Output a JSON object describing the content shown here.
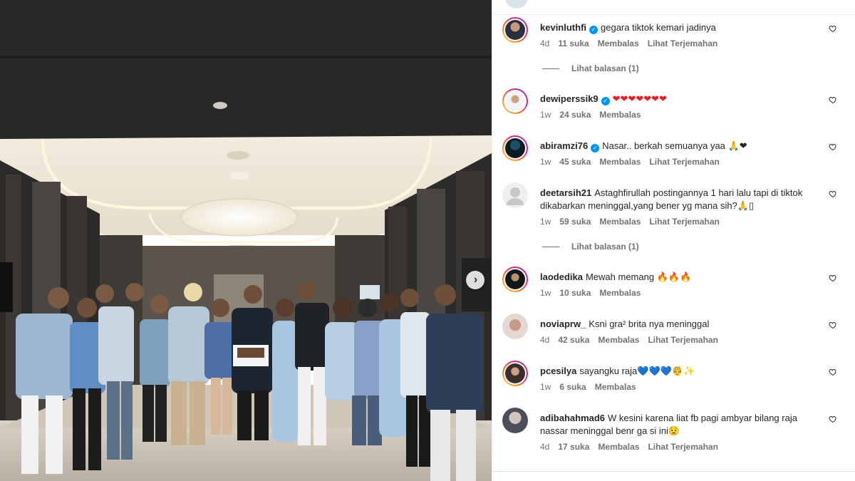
{
  "post": {
    "next_icon": "chevron-right-icon"
  },
  "comments": [
    {
      "username": "kevinluthfi",
      "verified": true,
      "text": "gegara tiktok kemari jadinya",
      "time": "4d",
      "likes": "11 suka",
      "reply": "Membalas",
      "translate": "Lihat Terjemahan",
      "view_replies": "Lihat balasan (1)"
    },
    {
      "username": "dewiperssik9",
      "verified": true,
      "text": "❤❤❤❤❤❤❤",
      "time": "1w",
      "likes": "24 suka",
      "reply": "Membalas"
    },
    {
      "username": "abiramzi76",
      "verified": true,
      "text": "Nasar.. berkah semuanya yaa 🙏❤",
      "time": "1w",
      "likes": "45 suka",
      "reply": "Membalas",
      "translate": "Lihat Terjemahan"
    },
    {
      "username": "deetarsih21",
      "verified": false,
      "text": "Astaghfirullah postingannya 1 hari lalu tapi di tiktok dikabarkan meninggal,yang bener yg mana sih?🙏▯",
      "time": "1w",
      "likes": "59 suka",
      "reply": "Membalas",
      "translate": "Lihat Terjemahan",
      "view_replies": "Lihat balasan (1)"
    },
    {
      "username": "laodedika",
      "verified": false,
      "text": "Mewah memang 🔥🔥🔥",
      "time": "1w",
      "likes": "10 suka",
      "reply": "Membalas"
    },
    {
      "username": "noviaprw_",
      "verified": false,
      "text": "Ksni gra² brita nya meninggal",
      "time": "4d",
      "likes": "42 suka",
      "reply": "Membalas",
      "translate": "Lihat Terjemahan"
    },
    {
      "username": "pcesilya",
      "verified": false,
      "text": "sayangku raja💙💙💙🤴✨",
      "time": "1w",
      "likes": "6 suka",
      "reply": "Membalas"
    },
    {
      "username": "adibahahmad6",
      "verified": false,
      "text": "W kesini karena liat fb pagi ambyar bilang raja nassar meninggal benr ga si ini😟",
      "time": "4d",
      "likes": "17 suka",
      "reply": "Membalas",
      "translate": "Lihat Terjemahan"
    }
  ],
  "colors": {
    "verified": "#0095f6",
    "meta_text": "#737373",
    "text": "#262626"
  }
}
